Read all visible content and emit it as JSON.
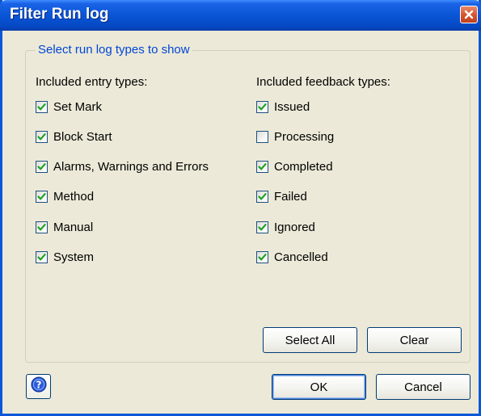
{
  "window": {
    "title": "Filter Run log"
  },
  "group": {
    "legend": "Select run log types to show"
  },
  "entry_types": {
    "heading": "Included entry types:",
    "items": [
      {
        "label": "Set Mark",
        "checked": true
      },
      {
        "label": "Block Start",
        "checked": true
      },
      {
        "label": "Alarms, Warnings and Errors",
        "checked": true
      },
      {
        "label": "Method",
        "checked": true
      },
      {
        "label": "Manual",
        "checked": true
      },
      {
        "label": "System",
        "checked": true
      }
    ]
  },
  "feedback_types": {
    "heading": "Included feedback types:",
    "items": [
      {
        "label": "Issued",
        "checked": true
      },
      {
        "label": "Processing",
        "checked": false
      },
      {
        "label": "Completed",
        "checked": true
      },
      {
        "label": "Failed",
        "checked": true
      },
      {
        "label": "Ignored",
        "checked": true
      },
      {
        "label": "Cancelled",
        "checked": true
      }
    ]
  },
  "buttons": {
    "select_all": "Select All",
    "clear": "Clear",
    "ok": "OK",
    "cancel": "Cancel"
  },
  "icons": {
    "close": "close-icon",
    "help": "help-icon",
    "check": "checkmark-icon"
  },
  "colors": {
    "titlebar": "#0a55d6",
    "dialog_bg": "#ece9d8",
    "legend_text": "#0046d5",
    "checkmark": "#21a121"
  }
}
